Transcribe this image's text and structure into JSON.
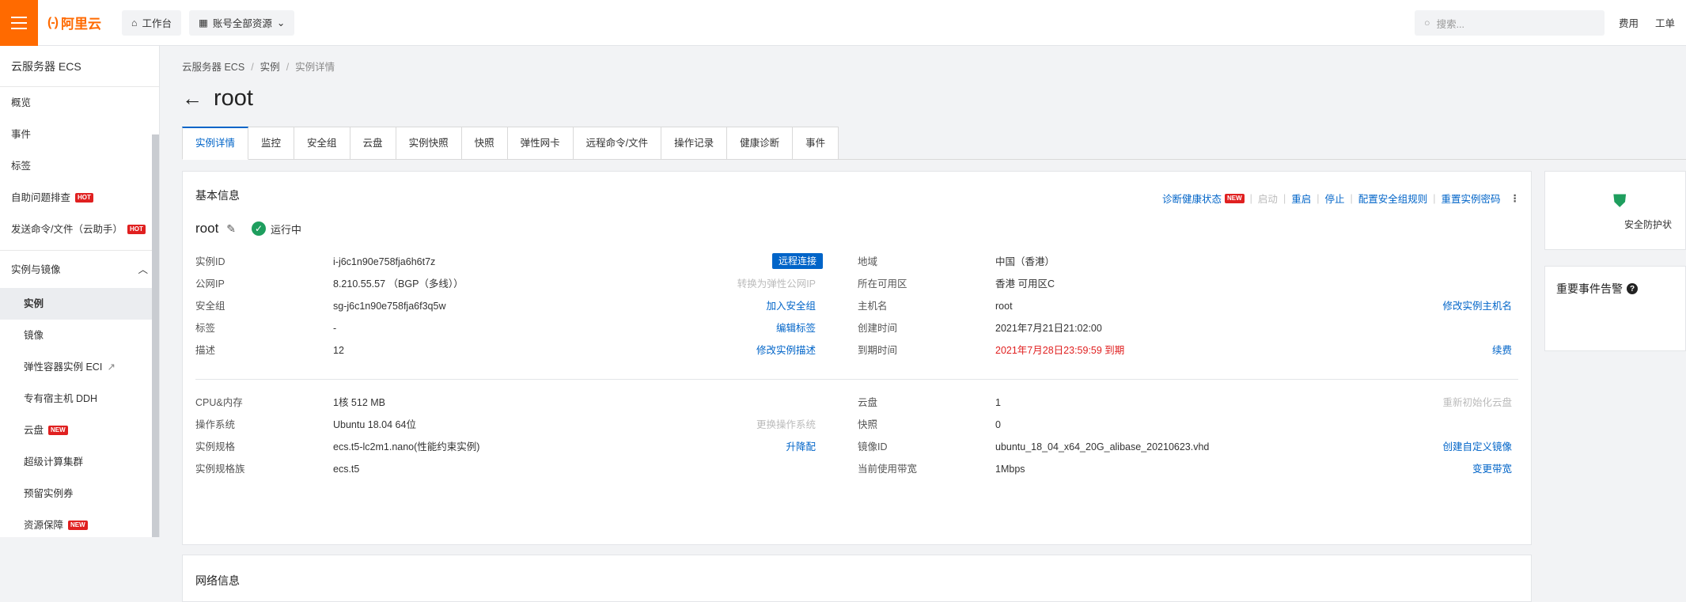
{
  "header": {
    "logo": "阿里云",
    "workbench": "工作台",
    "resources": "账号全部资源",
    "search_placeholder": "搜索...",
    "fees": "费用",
    "tickets": "工单"
  },
  "sidebar": {
    "title": "云服务器 ECS",
    "items": [
      {
        "label": "概览"
      },
      {
        "label": "事件"
      },
      {
        "label": "标签"
      },
      {
        "label": "自助问题排查",
        "badge": "HOT"
      },
      {
        "label": "发送命令/文件（云助手）",
        "badge": "HOT"
      }
    ],
    "section": "实例与镜像",
    "sub_items": [
      {
        "label": "实例"
      },
      {
        "label": "镜像"
      },
      {
        "label": "弹性容器实例 ECI"
      },
      {
        "label": "专有宿主机 DDH"
      },
      {
        "label": "云盘",
        "badge": "NEW"
      },
      {
        "label": "超级计算集群"
      },
      {
        "label": "预留实例券"
      },
      {
        "label": "资源保障",
        "badge": "NEW"
      }
    ]
  },
  "breadcrumb": [
    "云服务器 ECS",
    "实例",
    "实例详情"
  ],
  "page_title": "root",
  "tabs": [
    "实例详情",
    "监控",
    "安全组",
    "云盘",
    "实例快照",
    "快照",
    "弹性网卡",
    "远程命令/文件",
    "操作记录",
    "健康诊断",
    "事件"
  ],
  "basic": {
    "title": "基本信息",
    "actions": {
      "diagnose": "诊断健康状态",
      "diagnose_badge": "NEW",
      "start": "启动",
      "restart": "重启",
      "stop": "停止",
      "sg_rules": "配置安全组规则",
      "reset_pwd": "重置实例密码",
      "more": "⋮"
    },
    "name": "root",
    "status": "运行中",
    "left": [
      {
        "label": "实例ID",
        "value": "i-j6c1n90e758fja6h6t7z",
        "action": "远程连接"
      },
      {
        "label": "公网IP",
        "value": "8.210.55.57 （BGP（多线））",
        "action": "转换为弹性公网IP"
      },
      {
        "label": "安全组",
        "value": "sg-j6c1n90e758fja6f3q5w",
        "action": "加入安全组"
      },
      {
        "label": "标签",
        "value": "-",
        "action": "编辑标签"
      },
      {
        "label": "描述",
        "value": "12",
        "action": "修改实例描述"
      }
    ],
    "right": [
      {
        "label": "地域",
        "value": "中国（香港）",
        "action": ""
      },
      {
        "label": "所在可用区",
        "value": "香港 可用区C",
        "action": ""
      },
      {
        "label": "主机名",
        "value": "root",
        "action": "修改实例主机名"
      },
      {
        "label": "创建时间",
        "value": "2021年7月21日21:02:00",
        "action": ""
      },
      {
        "label": "到期时间",
        "value": "2021年7月28日23:59:59 到期",
        "action": "续费"
      }
    ],
    "left2": [
      {
        "label": "CPU&内存",
        "value": "1核 512 MB",
        "action": ""
      },
      {
        "label": "操作系统",
        "value": "Ubuntu 18.04 64位",
        "action": "更换操作系统"
      },
      {
        "label": "实例规格",
        "value": "ecs.t5-lc2m1.nano(性能约束实例)",
        "action": "升降配"
      },
      {
        "label": "实例规格族",
        "value": "ecs.t5",
        "action": ""
      }
    ],
    "right2": [
      {
        "label": "云盘",
        "value": "1",
        "action": "重新初始化云盘"
      },
      {
        "label": "快照",
        "value": "0",
        "action": ""
      },
      {
        "label": "镜像ID",
        "value": "ubuntu_18_04_x64_20G_alibase_20210623.vhd",
        "action": "创建自定义镜像"
      },
      {
        "label": "当前使用带宽",
        "value": "1Mbps",
        "action": "变更带宽"
      }
    ]
  },
  "network": {
    "title": "网络信息"
  },
  "side_cards": {
    "security": "安全防护状",
    "events": "重要事件告警"
  }
}
